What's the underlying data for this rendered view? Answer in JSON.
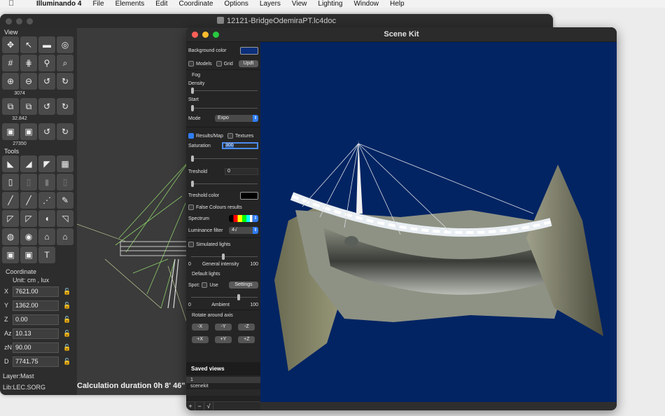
{
  "menubar": {
    "app_name": "Illuminando 4",
    "items": [
      "File",
      "Elements",
      "Edit",
      "Coordinate",
      "Options",
      "Layers",
      "View",
      "Lighting",
      "Window",
      "Help"
    ]
  },
  "main_window": {
    "title": "12121-BridgeOdemiraPT.lc4doc",
    "palette": {
      "view_label": "View",
      "tools_label": "Tools",
      "num_a": "3074",
      "num_b": "32.842",
      "num_c": "27350"
    },
    "coordinate": {
      "header": "Coordinate",
      "unit": "Unit:  cm , lux",
      "fields": [
        {
          "label": "X",
          "value": "7621.00"
        },
        {
          "label": "Y",
          "value": "1362.00"
        },
        {
          "label": "Z",
          "value": "0.00"
        },
        {
          "label": "Az",
          "value": "10.13"
        },
        {
          "label": "zN",
          "value": "90.00"
        },
        {
          "label": "D",
          "value": "7741.75"
        }
      ]
    },
    "layer": "Layer:Mast",
    "lib": "Lib:LEC.SORG",
    "calc": "Calculation duration 0h 8' 46\""
  },
  "scene_kit": {
    "title": "Scene Kit",
    "background_color_label": "Background color",
    "background_color": "#0b2f7a",
    "models_label": "Models",
    "grid_label": "Grid",
    "updt_label": "Updt",
    "fog_label": "Fog",
    "density_label": "Density",
    "start_label": "Start",
    "mode_label": "Mode",
    "mode_value": "Expo",
    "results_map_label": "Results/Map",
    "textures_label": "Textures",
    "saturation_label": "Saturation",
    "saturation_value": "300",
    "treshold_label": "Treshold",
    "treshold_value": "0",
    "treshold_color_label": "Treshold color",
    "false_colours_label": "False Colours results",
    "spectrum_label": "Spectrum",
    "luminance_filter_label": "Luminance filter",
    "luminance_filter_value": "4√",
    "simulated_lights_label": "Simulated lights",
    "general_intensity_label": "General intensity",
    "gi_min": "0",
    "gi_max": "100",
    "default_lights_label": "Default lights",
    "spot_label": "Spot:",
    "use_label": "Use",
    "settings_label": "Settings",
    "ambient_label": "Ambient",
    "amb_min": "0",
    "amb_max": "100",
    "rotate_label": "Rotate around axis",
    "rot_buttons": [
      "-X",
      "-Y",
      "-Z",
      "+X",
      "+Y",
      "+Z"
    ],
    "saved_views_label": "Saved views",
    "saved_views": [
      "1",
      "scenekit"
    ],
    "bottom_buttons": [
      "+",
      "−",
      "√"
    ]
  },
  "colors": {
    "scene_background": "#022463",
    "accent": "#2f7df6"
  }
}
